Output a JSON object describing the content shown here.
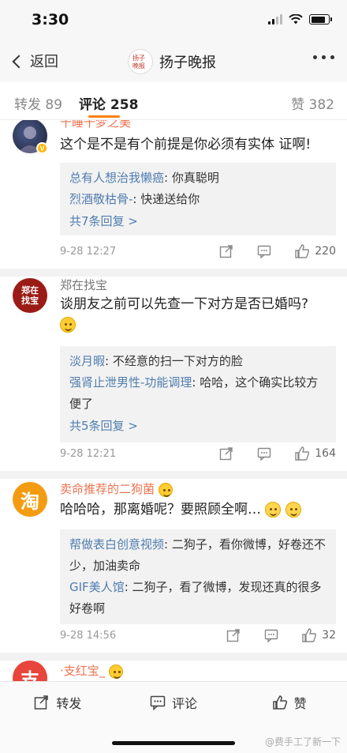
{
  "status_bar": {
    "time": "3:30",
    "battery_level": 0.85,
    "signal_bars": 4
  },
  "nav": {
    "back_label": "返回",
    "title": "扬子晚报",
    "logo_text": "扬子晚报"
  },
  "tabs": {
    "repost_label": "转发",
    "repost_count": "89",
    "comments_label": "评论",
    "comments_count": "258",
    "likes_label": "赞",
    "likes_count": "382"
  },
  "comments": [
    {
      "username": "十睡十梦之美",
      "text": "这个是不是有个前提是你必须有实体 证啊!",
      "replies": [
        {
          "user": "总有人想治我懒癌",
          "text": ": 你真聪明"
        },
        {
          "user": "烈酒敬枯骨-",
          "text": ": 快递送给你"
        }
      ],
      "more_replies": "共7条回复 >",
      "date": "9-28 12:27",
      "likes": "220"
    },
    {
      "username": "郑在找宝",
      "avatar_text": "郑在找宝",
      "text": "谈朋友之前可以先查一下对方是否已婚吗?",
      "replies": [
        {
          "user": "淡月暇",
          "text": ": 不经意的扫一下对方的脸"
        },
        {
          "user": "强肾止泄男性-功能调理",
          "text": ": 哈哈，这个确实比较方便了"
        }
      ],
      "more_replies": "共5条回复 >",
      "date": "9-28 12:21",
      "likes": "164"
    },
    {
      "username": "卖命推荐的二狗菌",
      "avatar_text": "淘",
      "text": "哈哈哈，那离婚呢？要照顾全啊…",
      "replies": [
        {
          "user": "帮做表白创意视频",
          "text": ": 二狗子，看你微博，好卷还不少，加油卖命"
        },
        {
          "user": "GIF美人馆",
          "text": ": 二狗子，看了微博，发现还真的很多好卷啊"
        }
      ],
      "date": "9-28 14:56",
      "likes": "32"
    },
    {
      "username": "·支红宝_",
      "avatar_text": "支"
    }
  ],
  "bottom_bar": {
    "repost_label": "转发",
    "comment_label": "评论",
    "like_label": "赞"
  },
  "watermark": "@费手工了新一下",
  "colors": {
    "accent": "#ff8200",
    "link": "#507daf",
    "vip_name": "#eb7350"
  }
}
